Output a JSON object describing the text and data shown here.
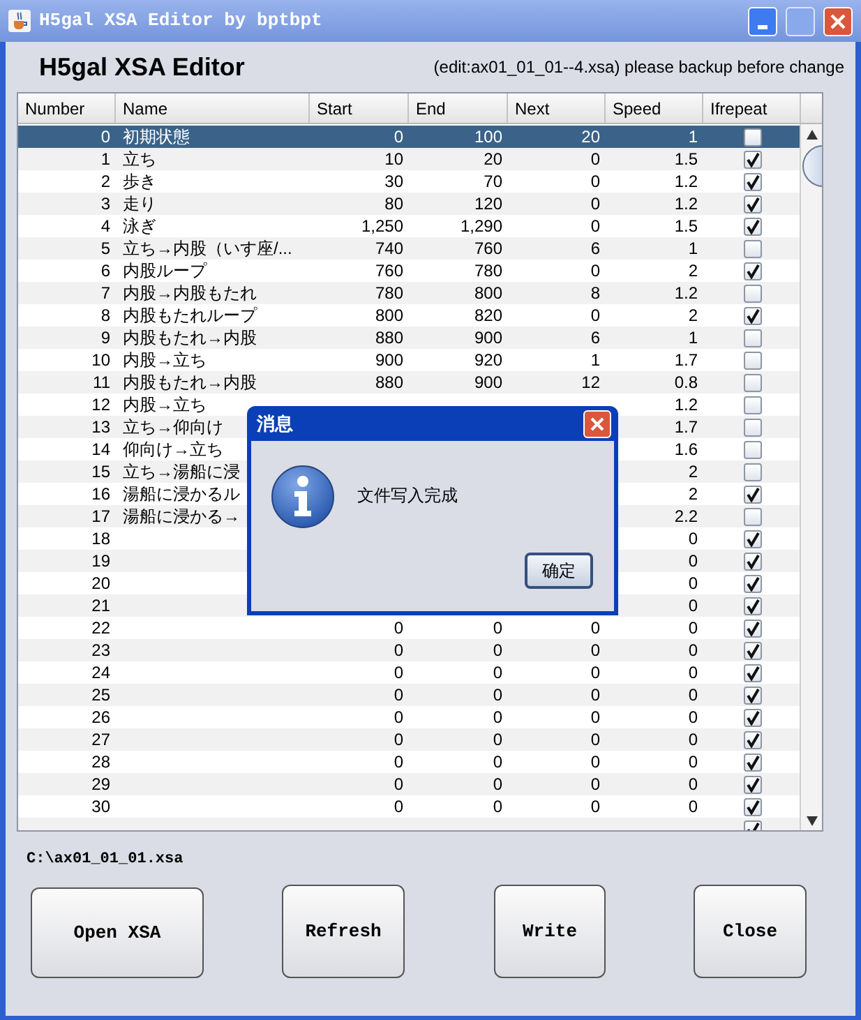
{
  "window": {
    "title": "H5gal XSA Editor by bptbpt"
  },
  "header": {
    "title": "H5gal XSA Editor",
    "note": "(edit:ax01_01_01--4.xsa) please backup before change"
  },
  "table": {
    "columns": [
      "Number",
      "Name",
      "Start",
      "End",
      "Next",
      "Speed",
      "Ifrepeat"
    ],
    "rows": [
      {
        "number": "0",
        "name": "初期状態",
        "start": "0",
        "end": "100",
        "next": "20",
        "speed": "1",
        "ifrepeat": false,
        "selected": true
      },
      {
        "number": "1",
        "name": "立ち",
        "start": "10",
        "end": "20",
        "next": "0",
        "speed": "1.5",
        "ifrepeat": true,
        "selected": false
      },
      {
        "number": "2",
        "name": "歩き",
        "start": "30",
        "end": "70",
        "next": "0",
        "speed": "1.2",
        "ifrepeat": true,
        "selected": false
      },
      {
        "number": "3",
        "name": "走り",
        "start": "80",
        "end": "120",
        "next": "0",
        "speed": "1.2",
        "ifrepeat": true,
        "selected": false
      },
      {
        "number": "4",
        "name": "泳ぎ",
        "start": "1,250",
        "end": "1,290",
        "next": "0",
        "speed": "1.5",
        "ifrepeat": true,
        "selected": false
      },
      {
        "number": "5",
        "name": "立ち→内股（いす座/...",
        "start": "740",
        "end": "760",
        "next": "6",
        "speed": "1",
        "ifrepeat": false,
        "selected": false
      },
      {
        "number": "6",
        "name": "内股ループ",
        "start": "760",
        "end": "780",
        "next": "0",
        "speed": "2",
        "ifrepeat": true,
        "selected": false
      },
      {
        "number": "7",
        "name": "内股→内股もたれ",
        "start": "780",
        "end": "800",
        "next": "8",
        "speed": "1.2",
        "ifrepeat": false,
        "selected": false
      },
      {
        "number": "8",
        "name": "内股もたれループ",
        "start": "800",
        "end": "820",
        "next": "0",
        "speed": "2",
        "ifrepeat": true,
        "selected": false
      },
      {
        "number": "9",
        "name": "内股もたれ→内股",
        "start": "880",
        "end": "900",
        "next": "6",
        "speed": "1",
        "ifrepeat": false,
        "selected": false
      },
      {
        "number": "10",
        "name": "内股→立ち",
        "start": "900",
        "end": "920",
        "next": "1",
        "speed": "1.7",
        "ifrepeat": false,
        "selected": false
      },
      {
        "number": "11",
        "name": "内股もたれ→内股",
        "start": "880",
        "end": "900",
        "next": "12",
        "speed": "0.8",
        "ifrepeat": false,
        "selected": false
      },
      {
        "number": "12",
        "name": "内股→立ち",
        "speed": "1.2",
        "ifrepeat": false,
        "selected": false
      },
      {
        "number": "13",
        "name": "立ち→仰向け",
        "speed": "1.7",
        "ifrepeat": false,
        "selected": false
      },
      {
        "number": "14",
        "name": "仰向け→立ち",
        "speed": "1.6",
        "ifrepeat": false,
        "selected": false
      },
      {
        "number": "15",
        "name": "立ち→湯船に浸",
        "speed": "2",
        "ifrepeat": false,
        "selected": false
      },
      {
        "number": "16",
        "name": "湯船に浸かるル",
        "speed": "2",
        "ifrepeat": true,
        "selected": false
      },
      {
        "number": "17",
        "name": "湯船に浸かる→",
        "speed": "2.2",
        "ifrepeat": false,
        "selected": false
      },
      {
        "number": "18",
        "speed": "0",
        "ifrepeat": true,
        "selected": false
      },
      {
        "number": "19",
        "speed": "0",
        "ifrepeat": true,
        "selected": false
      },
      {
        "number": "20",
        "speed": "0",
        "ifrepeat": true,
        "selected": false
      },
      {
        "number": "21",
        "speed": "0",
        "ifrepeat": true,
        "selected": false
      },
      {
        "number": "22",
        "start": "0",
        "end": "0",
        "next": "0",
        "speed": "0",
        "ifrepeat": true,
        "selected": false
      },
      {
        "number": "23",
        "start": "0",
        "end": "0",
        "next": "0",
        "speed": "0",
        "ifrepeat": true,
        "selected": false
      },
      {
        "number": "24",
        "start": "0",
        "end": "0",
        "next": "0",
        "speed": "0",
        "ifrepeat": true,
        "selected": false
      },
      {
        "number": "25",
        "start": "0",
        "end": "0",
        "next": "0",
        "speed": "0",
        "ifrepeat": true,
        "selected": false
      },
      {
        "number": "26",
        "start": "0",
        "end": "0",
        "next": "0",
        "speed": "0",
        "ifrepeat": true,
        "selected": false
      },
      {
        "number": "27",
        "start": "0",
        "end": "0",
        "next": "0",
        "speed": "0",
        "ifrepeat": true,
        "selected": false
      },
      {
        "number": "28",
        "start": "0",
        "end": "0",
        "next": "0",
        "speed": "0",
        "ifrepeat": true,
        "selected": false
      },
      {
        "number": "29",
        "start": "0",
        "end": "0",
        "next": "0",
        "speed": "0",
        "ifrepeat": true,
        "selected": false
      },
      {
        "number": "30",
        "start": "0",
        "end": "0",
        "next": "0",
        "speed": "0",
        "ifrepeat": true,
        "selected": false
      },
      {
        "ifrepeat": true,
        "selected": false
      }
    ]
  },
  "file_path": "C:\\ax01_01_01.xsa",
  "buttons": [
    "Open XSA",
    "Refresh",
    "Write",
    "Close"
  ],
  "dialog": {
    "title": "消息",
    "message": "文件写入完成",
    "button": "确定"
  }
}
